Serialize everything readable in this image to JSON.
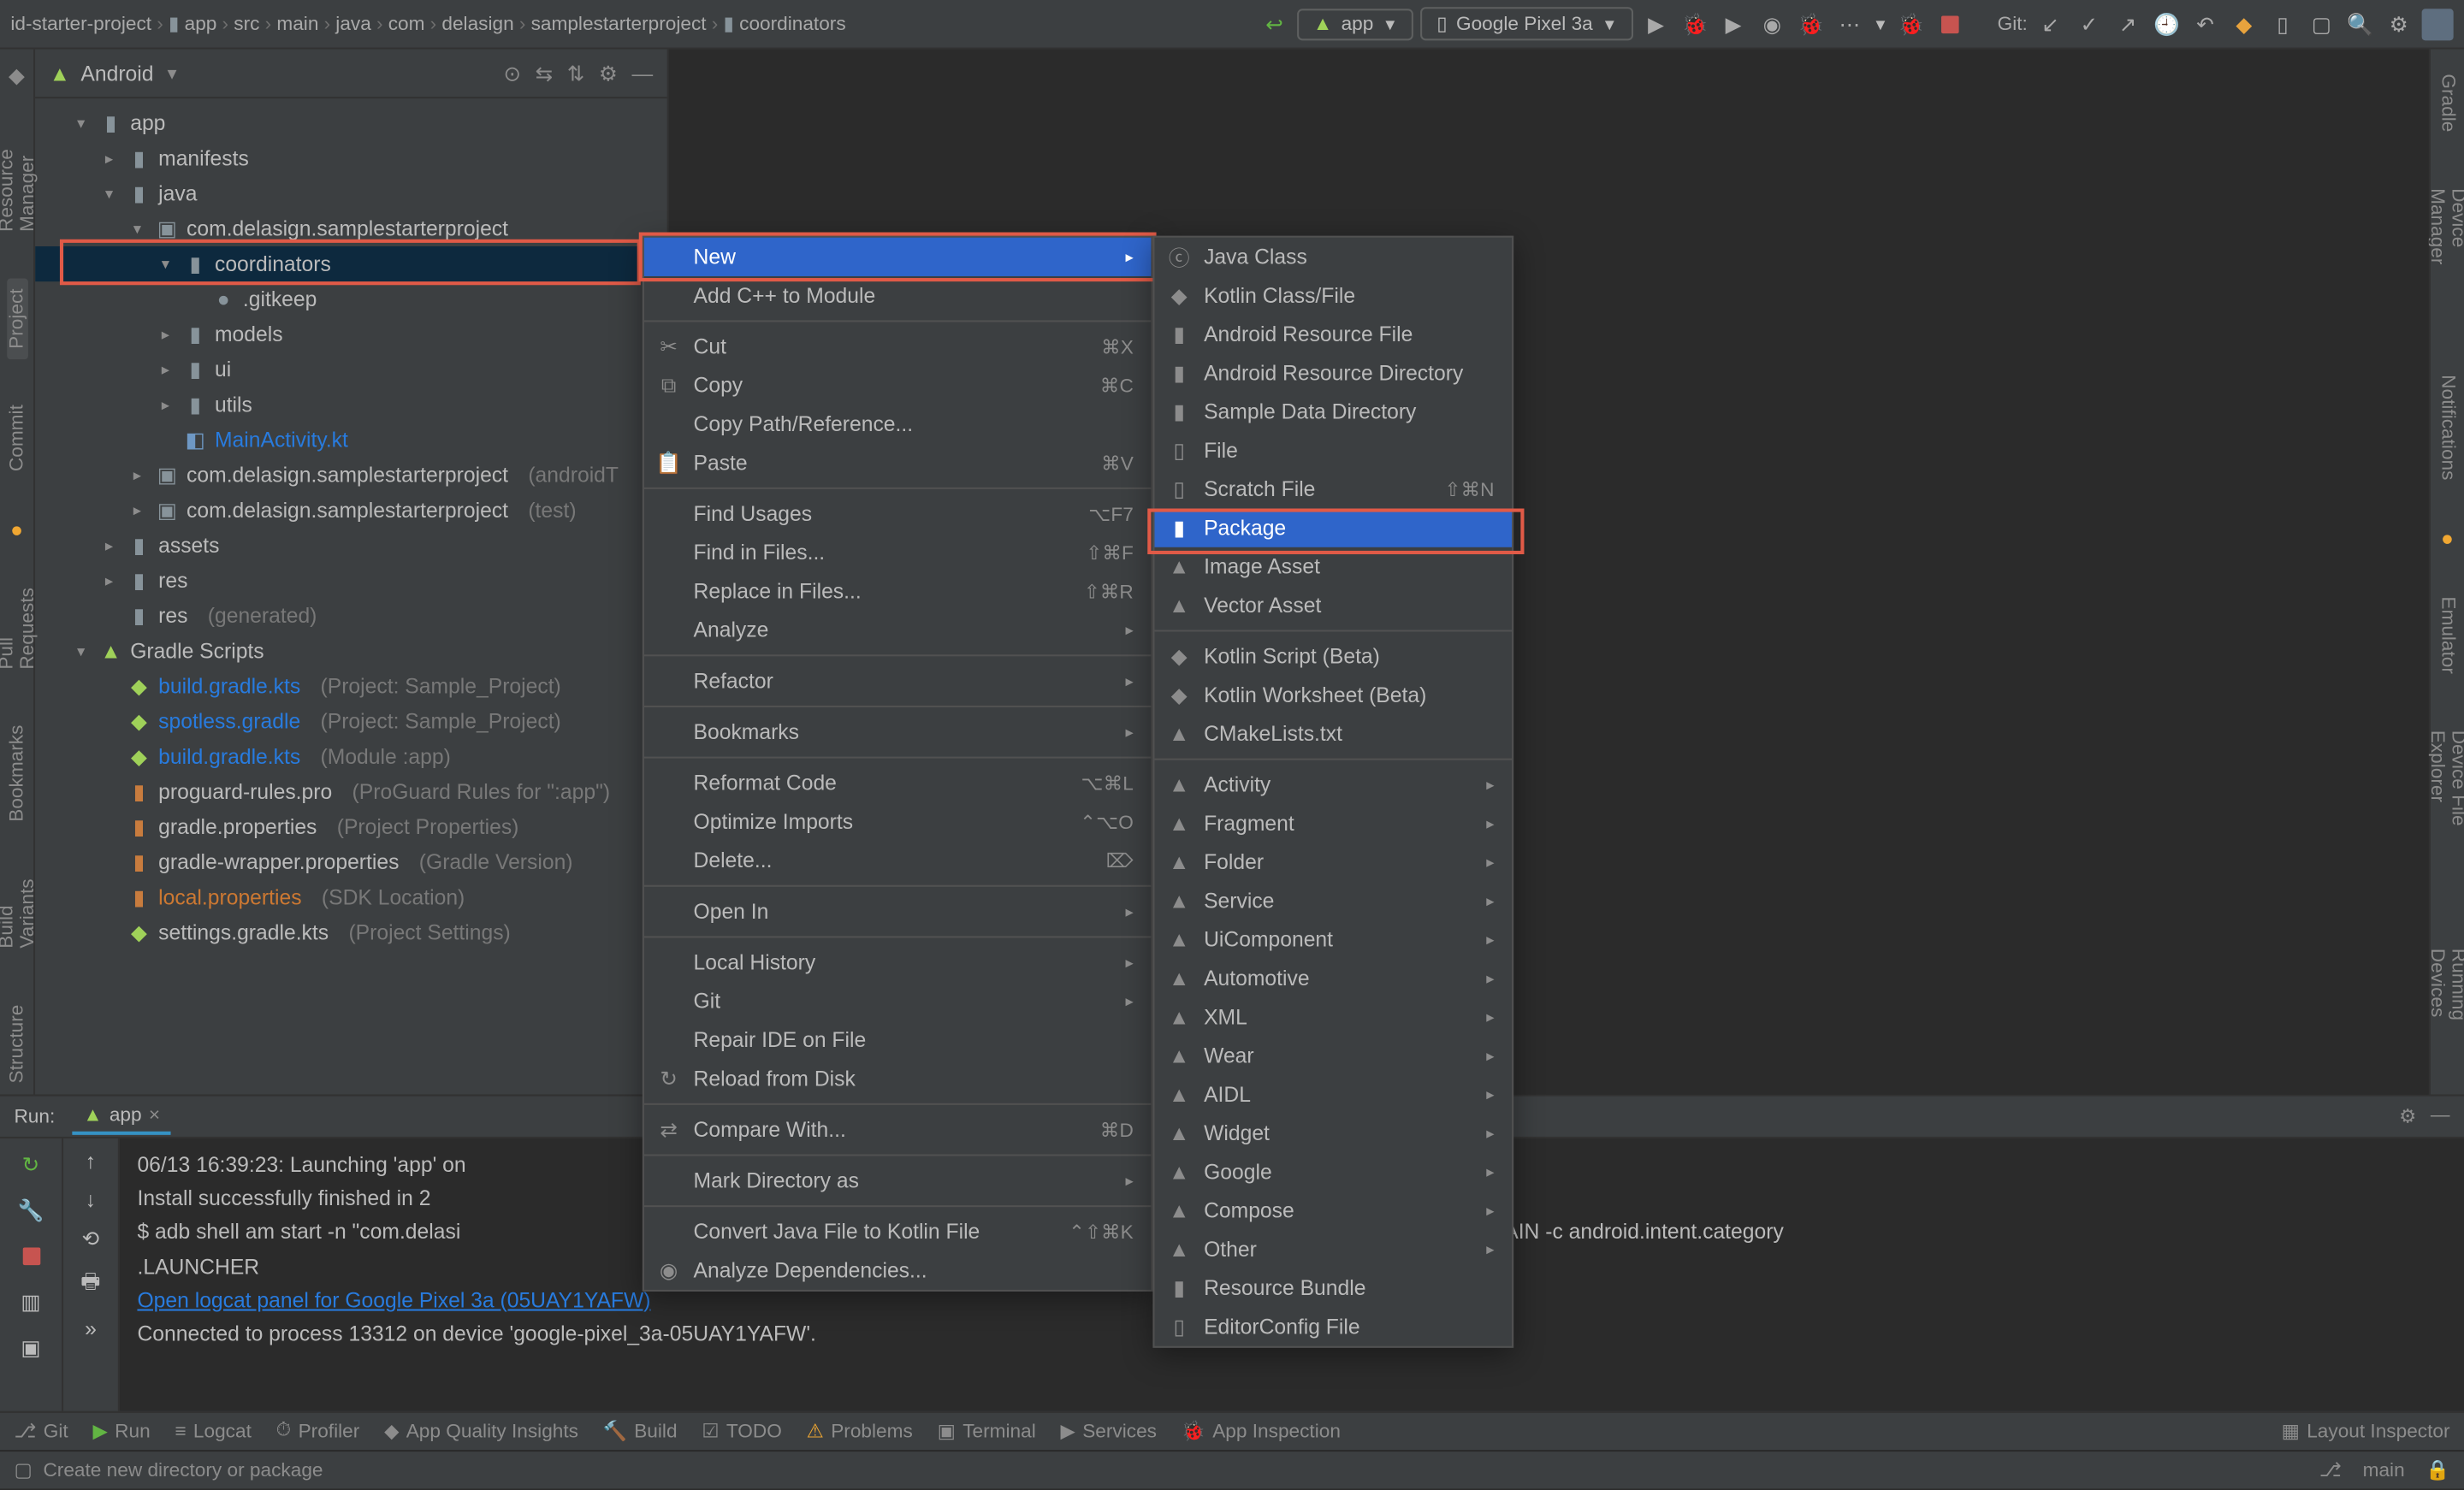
{
  "breadcrumb": [
    "id-starter-project",
    "app",
    "src",
    "main",
    "java",
    "com",
    "delasign",
    "samplestarterproject",
    "coordinators"
  ],
  "runConfig": {
    "name": "app"
  },
  "deviceSel": {
    "name": "Google Pixel 3a"
  },
  "topbar": {
    "gitLabel": "Git:"
  },
  "leftGutter": {
    "resourceManager": "Resource Manager",
    "project": "Project",
    "commit": "Commit",
    "pullRequests": "Pull Requests",
    "bookmarks": "Bookmarks",
    "structure": "Structure",
    "buildVariants": "Build Variants"
  },
  "rightGutter": {
    "gradle": "Gradle",
    "deviceManager": "Device Manager",
    "notifications": "Notifications",
    "emulator": "Emulator",
    "deviceFileExplorer": "Device File Explorer",
    "runningDevices": "Running Devices"
  },
  "projHeader": {
    "title": "Android"
  },
  "tree": {
    "app": "app",
    "manifests": "manifests",
    "java": "java",
    "pkg1": "com.delasign.samplestarterproject",
    "coordinators": "coordinators",
    "gitkeep": ".gitkeep",
    "models": "models",
    "ui": "ui",
    "utils": "utils",
    "mainActivity": "MainActivity.kt",
    "pkg2": "com.delasign.samplestarterproject",
    "pkg2suffix": "(androidT",
    "pkg3": "com.delasign.samplestarterproject",
    "pkg3suffix": "(test)",
    "assets": "assets",
    "res": "res",
    "resGen": "res",
    "resGenSuffix": "(generated)",
    "gradleScripts": "Gradle Scripts",
    "bg1": "build.gradle.kts",
    "bg1s": "(Project: Sample_Project)",
    "bg2": "spotless.gradle",
    "bg2s": "(Project: Sample_Project)",
    "bg3": "build.gradle.kts",
    "bg3s": "(Module :app)",
    "bg4": "proguard-rules.pro",
    "bg4s": "(ProGuard Rules for \":app\")",
    "bg5": "gradle.properties",
    "bg5s": "(Project Properties)",
    "bg6": "gradle-wrapper.properties",
    "bg6s": "(Gradle Version)",
    "bg7": "local.properties",
    "bg7s": "(SDK Location)",
    "bg8": "settings.gradle.kts",
    "bg8s": "(Project Settings)"
  },
  "ctx": {
    "new": "New",
    "cpp": "Add C++ to Module",
    "cut": "Cut",
    "cutk": "⌘X",
    "copy": "Copy",
    "copyk": "⌘C",
    "copyPath": "Copy Path/Reference...",
    "paste": "Paste",
    "pastek": "⌘V",
    "findUsages": "Find Usages",
    "findUsagesk": "⌥F7",
    "findInFiles": "Find in Files...",
    "findInFilesk": "⇧⌘F",
    "replaceInFiles": "Replace in Files...",
    "replaceInFilesk": "⇧⌘R",
    "analyze": "Analyze",
    "refactor": "Refactor",
    "bookmarks": "Bookmarks",
    "reformat": "Reformat Code",
    "reformatk": "⌥⌘L",
    "optimize": "Optimize Imports",
    "optimizek": "⌃⌥O",
    "delete": "Delete...",
    "deletek": "⌦",
    "openIn": "Open In",
    "localHistory": "Local History",
    "git": "Git",
    "repairIde": "Repair IDE on File",
    "reload": "Reload from Disk",
    "compare": "Compare With...",
    "comparek": "⌘D",
    "markDir": "Mark Directory as",
    "convert": "Convert Java File to Kotlin File",
    "convertk": "⌃⇧⌘K",
    "analyzeDeps": "Analyze Dependencies..."
  },
  "sub": {
    "javaClass": "Java Class",
    "ktClassFile": "Kotlin Class/File",
    "androidResFile": "Android Resource File",
    "androidResDir": "Android Resource Directory",
    "sampleDataDir": "Sample Data Directory",
    "file": "File",
    "scratch": "Scratch File",
    "scratchk": "⇧⌘N",
    "package": "Package",
    "imageAsset": "Image Asset",
    "vectorAsset": "Vector Asset",
    "ktScript": "Kotlin Script (Beta)",
    "ktWorksheet": "Kotlin Worksheet (Beta)",
    "cmake": "CMakeLists.txt",
    "activity": "Activity",
    "fragment": "Fragment",
    "folder": "Folder",
    "service": "Service",
    "uiComponent": "UiComponent",
    "automotive": "Automotive",
    "xml": "XML",
    "wear": "Wear",
    "aidl": "AIDL",
    "widget": "Widget",
    "google": "Google",
    "compose": "Compose",
    "other": "Other",
    "resourceBundle": "Resource Bundle",
    "editorConfig": "EditorConfig File"
  },
  "run": {
    "label": "Run:",
    "tab": "app",
    "line1": "06/13 16:39:23: Launching 'app' on",
    "line2": "Install successfully finished in 2",
    "line3a": "$ adb shell am start -n \"com.delasi",
    "line3b": "ctivity\" -a android.intent.action.MAIN -c android.intent.category",
    "line4": ".LAUNCHER",
    "link": "Open logcat panel for Google Pixel 3a (05UAY1YAFW)",
    "line5": "Connected to process 13312 on device 'google-pixel_3a-05UAY1YAFW'."
  },
  "bottom": {
    "git": "Git",
    "run": "Run",
    "logcat": "Logcat",
    "profiler": "Profiler",
    "appQuality": "App Quality Insights",
    "build": "Build",
    "todo": "TODO",
    "problems": "Problems",
    "terminal": "Terminal",
    "services": "Services",
    "appInspection": "App Inspection",
    "layoutInspector": "Layout Inspector"
  },
  "status": {
    "msg": "Create new directory or package",
    "branch": "main"
  }
}
